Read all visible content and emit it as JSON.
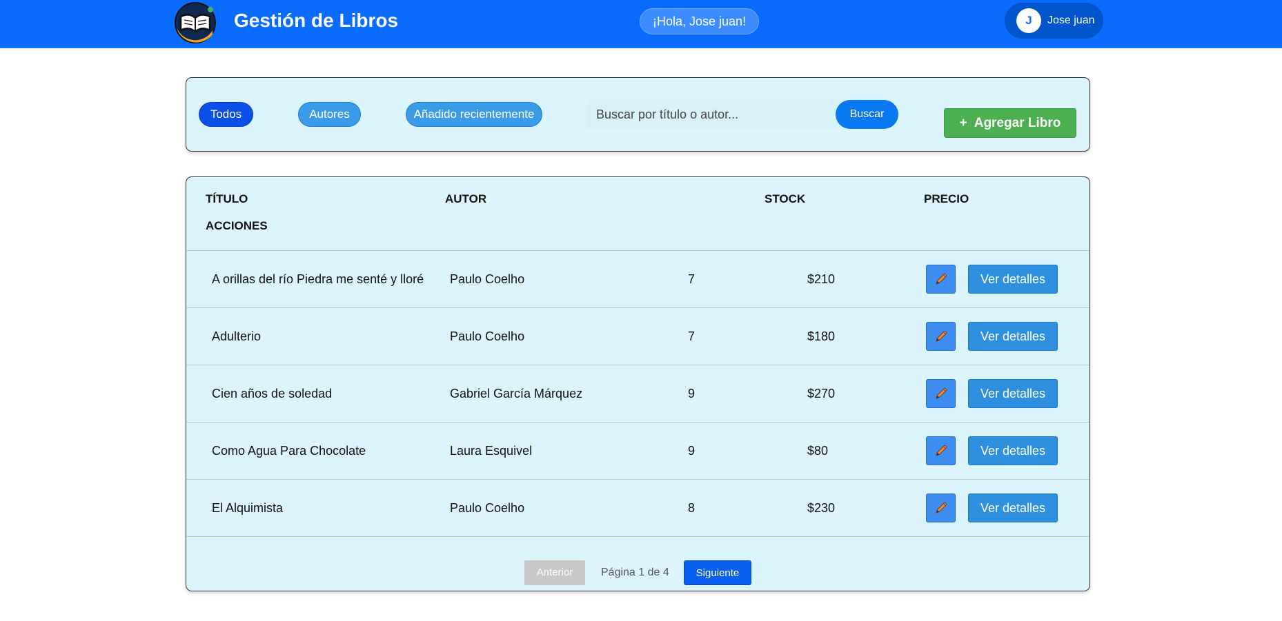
{
  "header": {
    "title": "Gestión de Libros",
    "greeting": "¡Hola, Jose juan!",
    "user": {
      "initial": "J",
      "name": "Jose juan"
    }
  },
  "filters": {
    "chips": [
      "Todos",
      "Autores",
      "Añadido recientemente"
    ],
    "active_chip": "Todos",
    "search_placeholder": "Buscar por título o autor...",
    "search_button": "Buscar",
    "add_button": "Agregar Libro"
  },
  "table": {
    "columns": {
      "title": "TÍTULO",
      "author": "AUTOR",
      "stock": "STOCK",
      "price": "PRECIO",
      "actions": "ACCIONES"
    },
    "details_label": "Ver detalles",
    "rows": [
      {
        "title": "A orillas del río Piedra me senté y lloré",
        "author": "Paulo Coelho",
        "stock": "7",
        "price": "$210"
      },
      {
        "title": "Adulterio",
        "author": "Paulo Coelho",
        "stock": "7",
        "price": "$180"
      },
      {
        "title": "Cien años de soledad",
        "author": "Gabriel García Márquez",
        "stock": "9",
        "price": "$270"
      },
      {
        "title": "Como Agua Para Chocolate",
        "author": "Laura Esquivel",
        "stock": "9",
        "price": "$80"
      },
      {
        "title": "El Alquimista",
        "author": "Paulo Coelho",
        "stock": "8",
        "price": "$230"
      }
    ]
  },
  "pagination": {
    "prev": "Anterior",
    "info": "Página 1 de 4",
    "next": "Siguiente"
  },
  "colors": {
    "header_bg": "#0a6cff",
    "panel_bg": "#dcf4fc",
    "add_button": "#4caf50",
    "details_button": "#2d8fdd"
  }
}
